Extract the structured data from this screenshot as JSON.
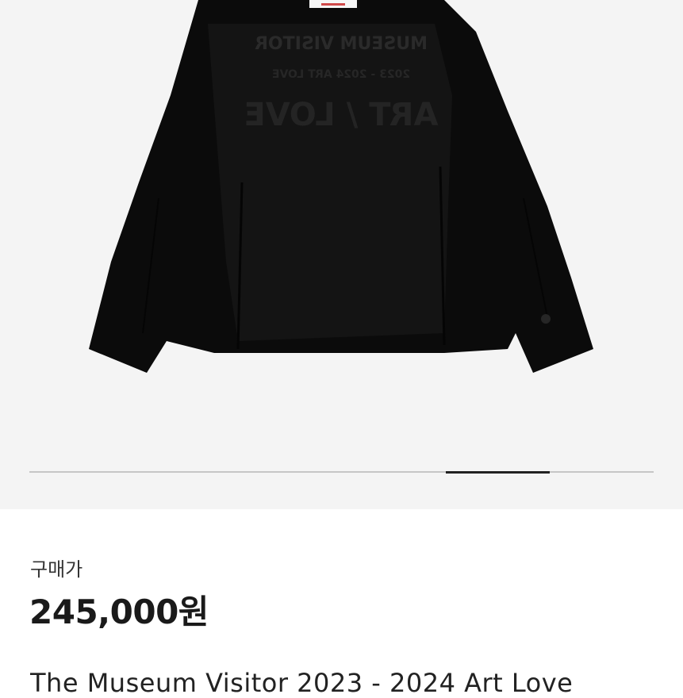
{
  "gallery": {
    "image_alt": "black jacket",
    "image_count": 6,
    "current_index": 5,
    "print_text": {
      "line1": "MUSEUM VISITOR",
      "line2": "2023 - 2024 ART LOVE",
      "line3": "ART / LOVE"
    },
    "colors": {
      "background": "#f4f4f4",
      "track": "#c6c6c6",
      "thumb": "#222222",
      "jacket": "#0b0b0b"
    }
  },
  "purchase": {
    "label": "구매가",
    "price": "245,000원"
  },
  "product": {
    "title": "The Museum Visitor 2023 - 2024 Art Love"
  }
}
